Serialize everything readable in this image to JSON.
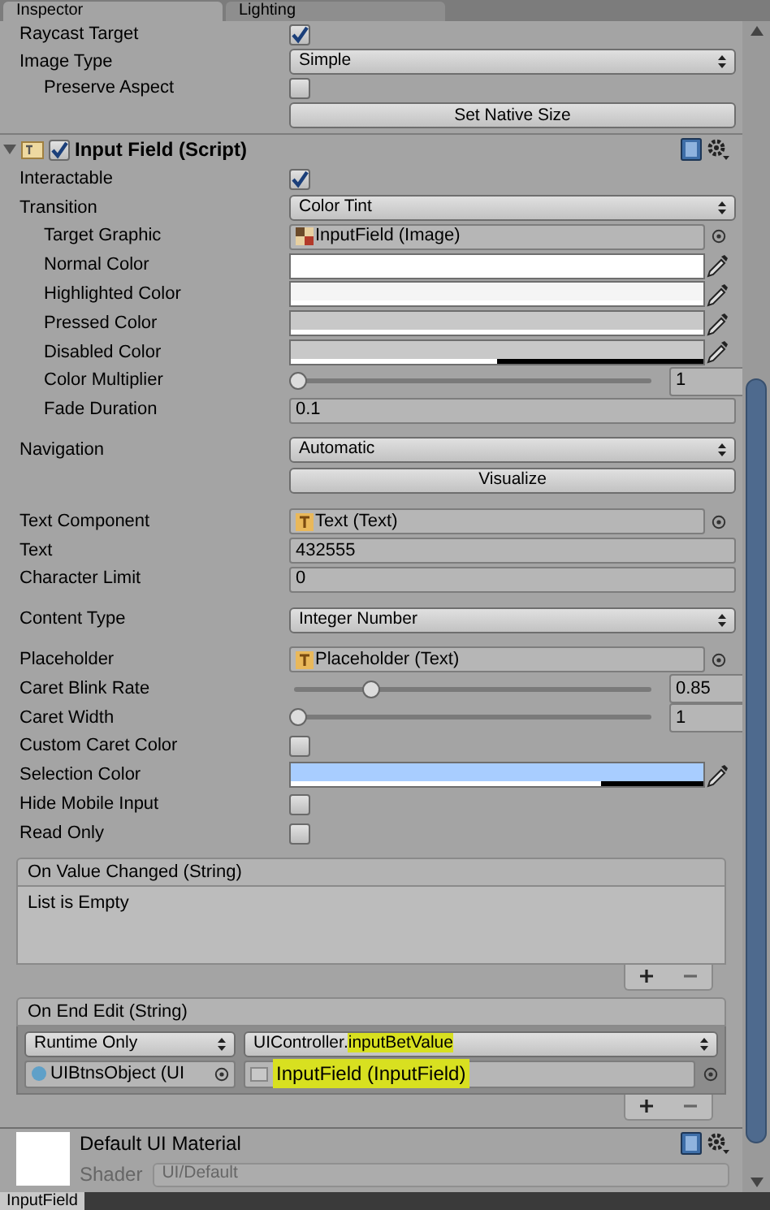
{
  "tabs": [
    {
      "label": "Inspector",
      "selected": true
    },
    {
      "label": "Lighting",
      "selected": false
    }
  ],
  "image_component": {
    "rows": [
      {
        "kind": "checkbox",
        "label": "Raycast Target",
        "checked": true
      },
      {
        "kind": "dropdown",
        "label": "Image Type",
        "value": "Simple",
        "children": [
          {
            "kind": "checkbox",
            "label": "Preserve Aspect",
            "checked": false
          }
        ]
      },
      {
        "kind": "button",
        "text": "Set Native Size"
      }
    ]
  },
  "input_field_component": {
    "title": "Input Field (Script)",
    "expanded": true,
    "enabled": true,
    "groups": [
      [
        {
          "kind": "checkbox",
          "label": "Interactable",
          "checked": true
        },
        {
          "kind": "dropdown",
          "label": "Transition",
          "value": "Color Tint",
          "children": [
            {
              "kind": "object",
              "label": "Target Graphic",
              "object": {
                "kind": "image",
                "name": "InputField (Image)"
              }
            },
            {
              "kind": "color",
              "label": "Normal Color",
              "color": "#ffffff",
              "level": 1
            },
            {
              "kind": "color",
              "label": "Highlighted Color",
              "color": "#f5f5f5",
              "level": 1
            },
            {
              "kind": "color",
              "label": "Pressed Color",
              "color": "#c8c8c8",
              "level": 1
            },
            {
              "kind": "color",
              "label": "Disabled Color",
              "color": "#c8c8c8",
              "level": 0.5
            },
            {
              "kind": "slider",
              "label": "Color Multiplier",
              "level": 0,
              "value": "1"
            },
            {
              "kind": "number",
              "label": "Fade Duration",
              "value": "0.1"
            }
          ]
        }
      ],
      [
        {
          "kind": "dropdown",
          "label": "Navigation",
          "value": "Automatic"
        },
        {
          "kind": "button",
          "text": "Visualize"
        }
      ],
      [
        {
          "kind": "object",
          "label": "Text Component",
          "object": {
            "kind": "text",
            "name": "Text (Text)"
          }
        },
        {
          "kind": "number",
          "label": "Text",
          "value": "432555"
        },
        {
          "kind": "number",
          "label": "Character Limit",
          "value": "0"
        }
      ],
      [
        {
          "kind": "dropdown",
          "label": "Content Type",
          "value": "Integer Number"
        }
      ],
      [
        {
          "kind": "object",
          "label": "Placeholder",
          "object": {
            "kind": "text",
            "name": "Placeholder (Text)"
          }
        },
        {
          "kind": "slider",
          "label": "Caret Blink Rate",
          "level": 0.21,
          "value": "0.85"
        },
        {
          "kind": "slider",
          "label": "Caret Width",
          "level": 0,
          "value": "1"
        },
        {
          "kind": "checkbox",
          "label": "Custom Caret Color",
          "checked": false
        },
        {
          "kind": "color",
          "label": "Selection Color",
          "color": "#a8cdff",
          "level": 0.75
        },
        {
          "kind": "checkbox",
          "label": "Hide Mobile Input",
          "checked": false
        },
        {
          "kind": "checkbox",
          "label": "Read Only",
          "checked": false
        }
      ]
    ]
  },
  "events": [
    {
      "title": "On Value Changed (String)",
      "empty_text": "List is Empty"
    },
    {
      "title": "On End Edit (String)",
      "listeners": [
        {
          "call_state": "Runtime Only",
          "target": "UIBtnsObject (UI",
          "function_prefix": "UIController.",
          "function_name": "inputBetValue",
          "function_highlighted": true,
          "argument": "InputField (InputField)",
          "argument_highlighted": true
        }
      ]
    }
  ],
  "material": {
    "name": "Default UI Material",
    "shader_label": "Shader",
    "shader": "UI/Default"
  },
  "footer": {
    "label": "InputField"
  }
}
